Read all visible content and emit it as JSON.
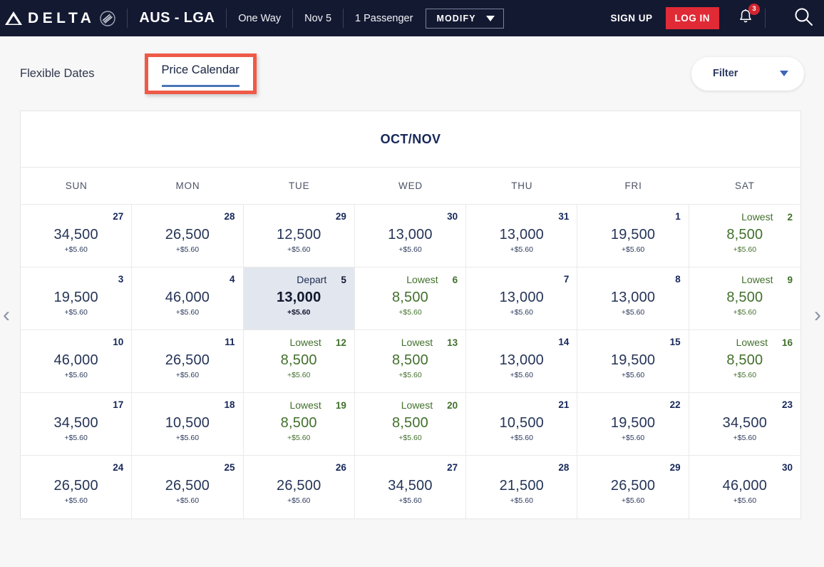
{
  "header": {
    "brand": "DELTA",
    "brand_widget": "delta-triangle-logo",
    "alliance": "skyteam-logo",
    "route": "AUS - LGA",
    "trip_type": "One Way",
    "date": "Nov 5",
    "passengers": "1 Passenger",
    "modify_label": "MODIFY",
    "signup_label": "SIGN UP",
    "login_label": "LOG IN",
    "notification_count": "3",
    "search_icon": "search-icon",
    "colors": {
      "nav_background": "#141932",
      "login_red": "#e02a36",
      "badge_red": "#d2262f"
    }
  },
  "tabs": {
    "flexible_dates": "Flexible Dates",
    "price_calendar": "Price Calendar",
    "active": "Price Calendar",
    "highlight_color": "#ef5a47",
    "underline_color": "#4a76b8"
  },
  "filter": {
    "label": "Filter",
    "icon": "chevron-down-icon"
  },
  "calendar": {
    "title": "OCT/NOV",
    "weekdays": [
      "SUN",
      "MON",
      "TUE",
      "WED",
      "THU",
      "FRI",
      "SAT"
    ],
    "prev_arrow": "‹",
    "next_arrow": "›",
    "fee_text": "+$5.60",
    "lowest_label": "Lowest",
    "depart_label": "Depart",
    "lowest_color": "#42702c",
    "selected_bg": "#e2e6ef",
    "weeks": [
      [
        {
          "day": "27",
          "miles": "34,500",
          "fee": "+$5.60",
          "tag": "",
          "state": "normal"
        },
        {
          "day": "28",
          "miles": "26,500",
          "fee": "+$5.60",
          "tag": "",
          "state": "normal"
        },
        {
          "day": "29",
          "miles": "12,500",
          "fee": "+$5.60",
          "tag": "",
          "state": "normal"
        },
        {
          "day": "30",
          "miles": "13,000",
          "fee": "+$5.60",
          "tag": "",
          "state": "normal"
        },
        {
          "day": "31",
          "miles": "13,000",
          "fee": "+$5.60",
          "tag": "",
          "state": "normal"
        },
        {
          "day": "1",
          "miles": "19,500",
          "fee": "+$5.60",
          "tag": "",
          "state": "normal"
        },
        {
          "day": "2",
          "miles": "8,500",
          "fee": "+$5.60",
          "tag": "Lowest",
          "state": "lowest"
        }
      ],
      [
        {
          "day": "3",
          "miles": "19,500",
          "fee": "+$5.60",
          "tag": "",
          "state": "normal"
        },
        {
          "day": "4",
          "miles": "46,000",
          "fee": "+$5.60",
          "tag": "",
          "state": "normal"
        },
        {
          "day": "5",
          "miles": "13,000",
          "fee": "+$5.60",
          "tag": "Depart",
          "state": "depart"
        },
        {
          "day": "6",
          "miles": "8,500",
          "fee": "+$5.60",
          "tag": "Lowest",
          "state": "lowest"
        },
        {
          "day": "7",
          "miles": "13,000",
          "fee": "+$5.60",
          "tag": "",
          "state": "normal"
        },
        {
          "day": "8",
          "miles": "13,000",
          "fee": "+$5.60",
          "tag": "",
          "state": "normal"
        },
        {
          "day": "9",
          "miles": "8,500",
          "fee": "+$5.60",
          "tag": "Lowest",
          "state": "lowest"
        }
      ],
      [
        {
          "day": "10",
          "miles": "46,000",
          "fee": "+$5.60",
          "tag": "",
          "state": "normal"
        },
        {
          "day": "11",
          "miles": "26,500",
          "fee": "+$5.60",
          "tag": "",
          "state": "normal"
        },
        {
          "day": "12",
          "miles": "8,500",
          "fee": "+$5.60",
          "tag": "Lowest",
          "state": "lowest"
        },
        {
          "day": "13",
          "miles": "8,500",
          "fee": "+$5.60",
          "tag": "Lowest",
          "state": "lowest"
        },
        {
          "day": "14",
          "miles": "13,000",
          "fee": "+$5.60",
          "tag": "",
          "state": "normal"
        },
        {
          "day": "15",
          "miles": "19,500",
          "fee": "+$5.60",
          "tag": "",
          "state": "normal"
        },
        {
          "day": "16",
          "miles": "8,500",
          "fee": "+$5.60",
          "tag": "Lowest",
          "state": "lowest"
        }
      ],
      [
        {
          "day": "17",
          "miles": "34,500",
          "fee": "+$5.60",
          "tag": "",
          "state": "normal"
        },
        {
          "day": "18",
          "miles": "10,500",
          "fee": "+$5.60",
          "tag": "",
          "state": "normal"
        },
        {
          "day": "19",
          "miles": "8,500",
          "fee": "+$5.60",
          "tag": "Lowest",
          "state": "lowest"
        },
        {
          "day": "20",
          "miles": "8,500",
          "fee": "+$5.60",
          "tag": "Lowest",
          "state": "lowest"
        },
        {
          "day": "21",
          "miles": "10,500",
          "fee": "+$5.60",
          "tag": "",
          "state": "normal"
        },
        {
          "day": "22",
          "miles": "19,500",
          "fee": "+$5.60",
          "tag": "",
          "state": "normal"
        },
        {
          "day": "23",
          "miles": "34,500",
          "fee": "+$5.60",
          "tag": "",
          "state": "normal"
        }
      ],
      [
        {
          "day": "24",
          "miles": "26,500",
          "fee": "+$5.60",
          "tag": "",
          "state": "normal"
        },
        {
          "day": "25",
          "miles": "26,500",
          "fee": "+$5.60",
          "tag": "",
          "state": "normal"
        },
        {
          "day": "26",
          "miles": "26,500",
          "fee": "+$5.60",
          "tag": "",
          "state": "normal"
        },
        {
          "day": "27",
          "miles": "34,500",
          "fee": "+$5.60",
          "tag": "",
          "state": "normal"
        },
        {
          "day": "28",
          "miles": "21,500",
          "fee": "+$5.60",
          "tag": "",
          "state": "normal"
        },
        {
          "day": "29",
          "miles": "26,500",
          "fee": "+$5.60",
          "tag": "",
          "state": "normal"
        },
        {
          "day": "30",
          "miles": "46,000",
          "fee": "+$5.60",
          "tag": "",
          "state": "normal"
        }
      ]
    ]
  }
}
